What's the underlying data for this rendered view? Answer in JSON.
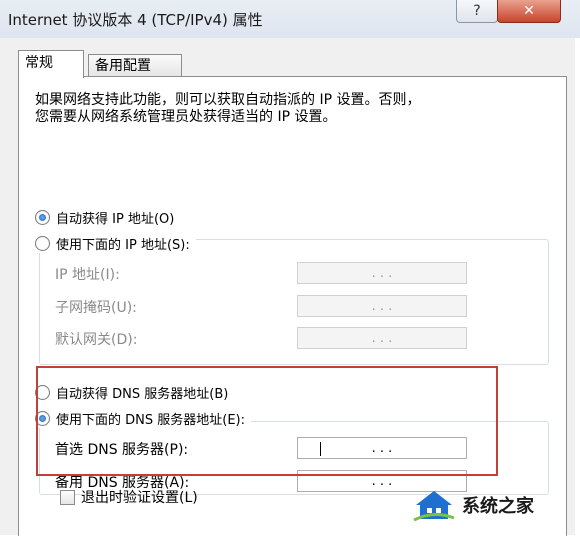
{
  "window": {
    "title": "Internet 协议版本 4 (TCP/IPv4) 属性",
    "help_glyph": "?",
    "close_glyph": "✕"
  },
  "tabs": [
    {
      "label": "常规",
      "active": true
    },
    {
      "label": "备用配置",
      "active": false
    }
  ],
  "intro": [
    "如果网络支持此功能，则可以获取自动指派的 IP 设置。否则，",
    "您需要从网络系统管理员处获得适当的 IP 设置。"
  ],
  "ip": {
    "auto_label": "自动获得 IP 地址(O)",
    "auto_selected": true,
    "manual_label": "使用下面的 IP 地址(S):",
    "manual_selected": false,
    "fields": [
      {
        "label": "IP 地址(I):",
        "dots": ".  .  ."
      },
      {
        "label": "子网掩码(U):",
        "dots": ".  .  ."
      },
      {
        "label": "默认网关(D):",
        "dots": ".  .  ."
      }
    ]
  },
  "dns": {
    "auto_label": "自动获得 DNS 服务器地址(B)",
    "auto_selected": false,
    "manual_label": "使用下面的 DNS 服务器地址(E):",
    "manual_selected": true,
    "fields": [
      {
        "label": "首选 DNS 服务器(P):",
        "dots": ".  .  ."
      },
      {
        "label": "备用 DNS 服务器(A):",
        "dots": ".  .  ."
      }
    ]
  },
  "validate": {
    "label": "退出时验证设置(L)",
    "checked": false
  },
  "watermark": {
    "text": "系统之家"
  },
  "colors": {
    "highlight": "#c2403a",
    "title_bar": "#dde5ef",
    "close": "#c8452c"
  }
}
